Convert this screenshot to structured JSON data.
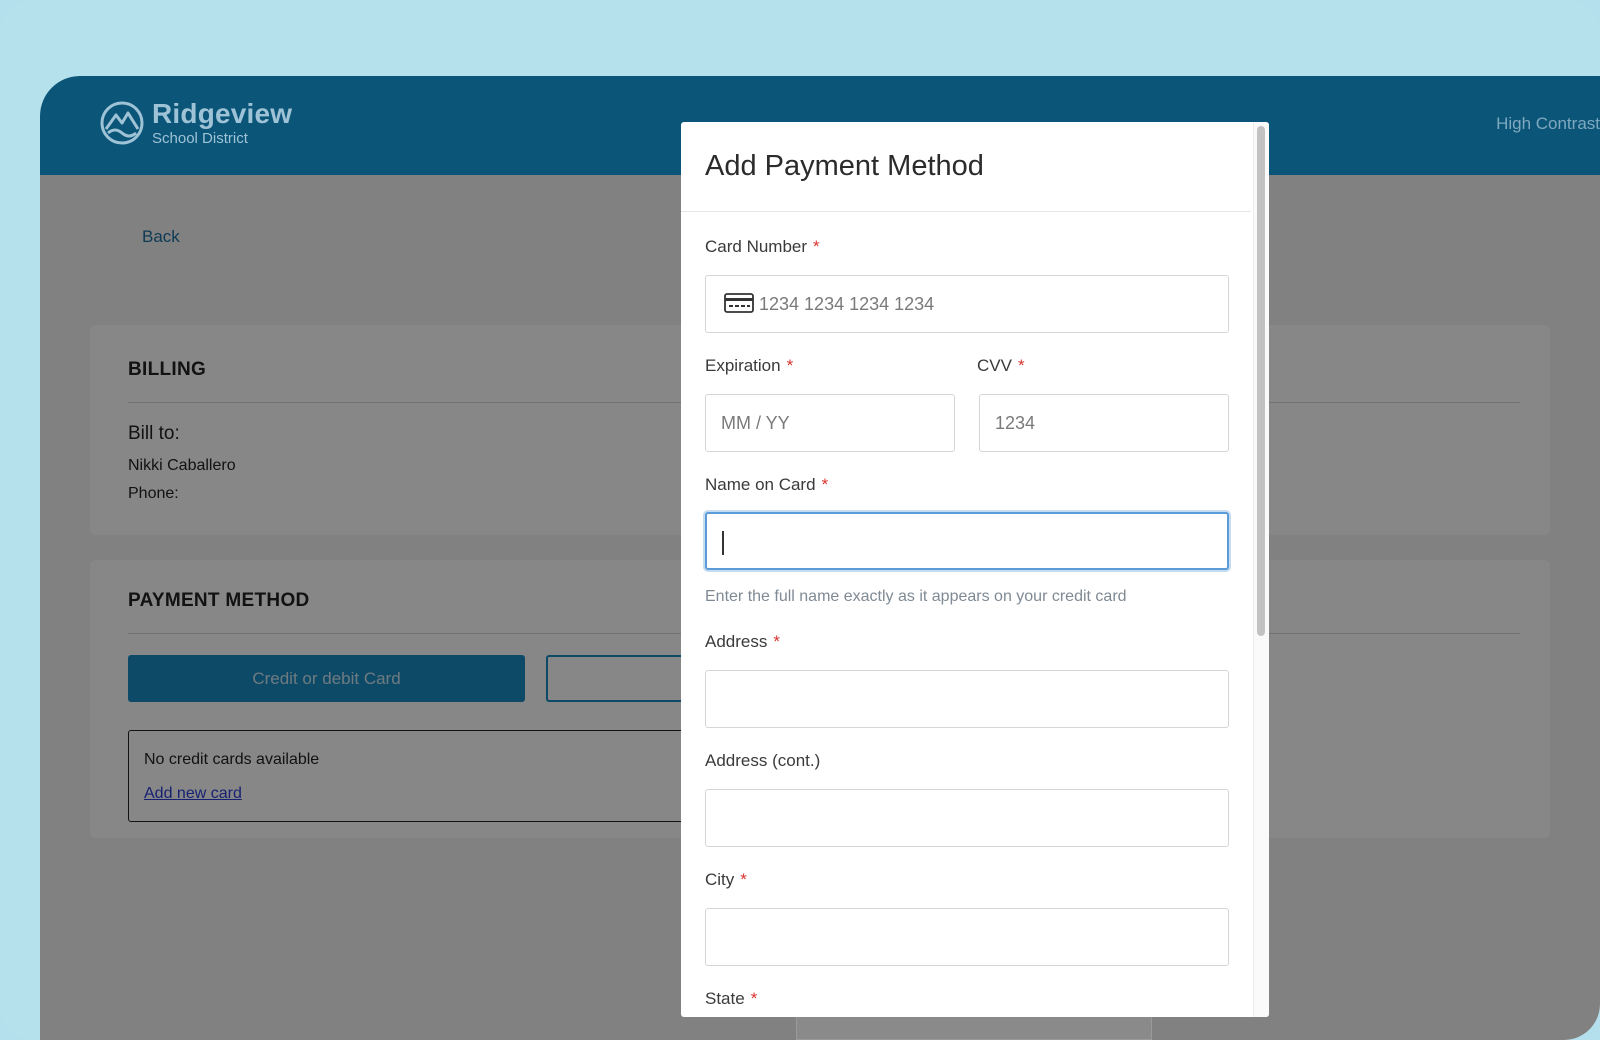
{
  "colors": {
    "header_bg": "#0b5578",
    "accent": "#1a8cc4",
    "required": "#d9332f",
    "focus": "#5b9bd8",
    "link": "#2a3fd8"
  },
  "header": {
    "logo_icon": "mountain-wave-icon",
    "brand_title": "Ridgeview",
    "brand_subtitle": "School District",
    "high_contrast": "High Contrast"
  },
  "page": {
    "back_label": "Back",
    "billing": {
      "title": "BILLING",
      "bill_to_label": "Bill to:",
      "name": "Nikki Caballero",
      "phone_label": "Phone:"
    },
    "payment": {
      "title": "PAYMENT METHOD",
      "primary_button": "Credit or debit Card",
      "empty_text": "No credit cards available",
      "add_link": "Add new card"
    }
  },
  "modal": {
    "title": "Add Payment Method",
    "required_mark": "*",
    "fields": {
      "card_number": {
        "label": "Card Number",
        "placeholder": "1234 1234 1234 1234",
        "icon": "credit-card-icon"
      },
      "expiration": {
        "label": "Expiration",
        "placeholder": "MM / YY"
      },
      "cvv": {
        "label": "CVV",
        "placeholder": "1234"
      },
      "name_on_card": {
        "label": "Name on Card",
        "value": "",
        "hint": "Enter the full name exactly as it appears on your credit card"
      },
      "address": {
        "label": "Address",
        "value": ""
      },
      "address2": {
        "label": "Address (cont.)",
        "value": ""
      },
      "city": {
        "label": "City",
        "value": ""
      },
      "state": {
        "label": "State"
      }
    }
  }
}
